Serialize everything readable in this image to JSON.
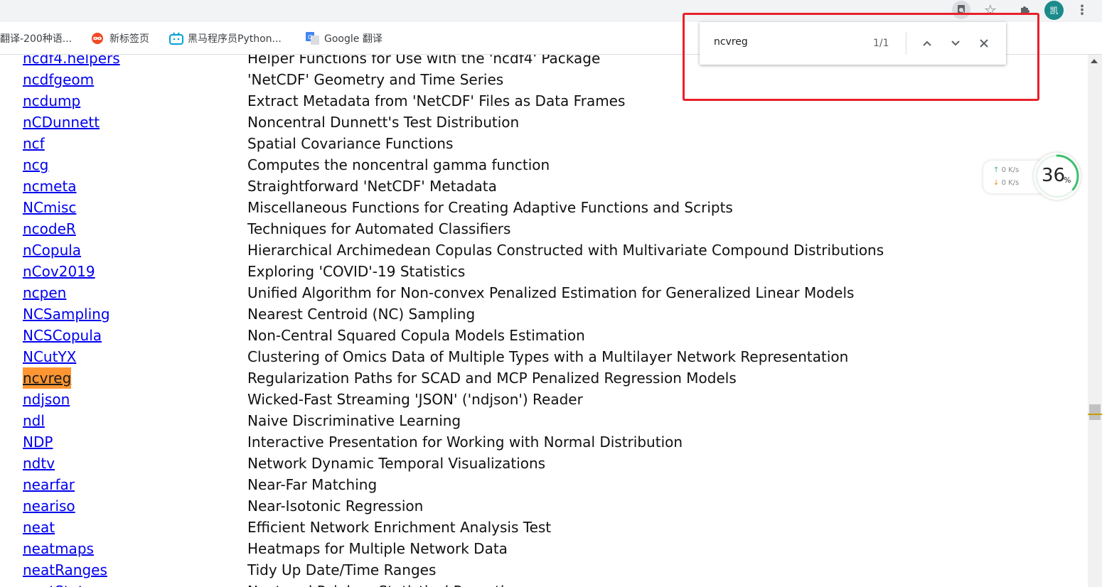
{
  "bookmarks": [
    {
      "label": "翻译-200种语...",
      "icon": "translate-icon"
    },
    {
      "label": "新标签页",
      "icon": "infinity-icon"
    },
    {
      "label": "黑马程序员Python...",
      "icon": "bilibili-icon"
    },
    {
      "label": "Google 翻译",
      "icon": "google-translate-icon"
    }
  ],
  "toolbar": {
    "avatar_text": "凯"
  },
  "find": {
    "query": "ncvreg",
    "count": "1/1"
  },
  "widget": {
    "upload": "0  K/s",
    "download": "0  K/s",
    "cpu_value": "36",
    "cpu_unit": "%",
    "cpu_percent": 36
  },
  "packages": [
    {
      "name": "ncdf4.helpers",
      "desc": "Helper Functions for Use with the 'ncdf4' Package"
    },
    {
      "name": "ncdfgeom",
      "desc": "'NetCDF' Geometry and Time Series"
    },
    {
      "name": "ncdump",
      "desc": "Extract Metadata from 'NetCDF' Files as Data Frames"
    },
    {
      "name": "nCDunnett",
      "desc": "Noncentral Dunnett's Test Distribution"
    },
    {
      "name": "ncf",
      "desc": "Spatial Covariance Functions"
    },
    {
      "name": "ncg",
      "desc": "Computes the noncentral gamma function"
    },
    {
      "name": "ncmeta",
      "desc": "Straightforward 'NetCDF' Metadata"
    },
    {
      "name": "NCmisc",
      "desc": "Miscellaneous Functions for Creating Adaptive Functions and Scripts"
    },
    {
      "name": "ncodeR",
      "desc": "Techniques for Automated Classifiers"
    },
    {
      "name": "nCopula",
      "desc": "Hierarchical Archimedean Copulas Constructed with Multivariate Compound Distributions"
    },
    {
      "name": "nCov2019",
      "desc": "Exploring 'COVID'-19 Statistics"
    },
    {
      "name": "ncpen",
      "desc": "Unified Algorithm for Non-convex Penalized Estimation for Generalized Linear Models"
    },
    {
      "name": "NCSampling",
      "desc": "Nearest Centroid (NC) Sampling"
    },
    {
      "name": "NCSCopula",
      "desc": "Non-Central Squared Copula Models Estimation"
    },
    {
      "name": "NCutYX",
      "desc": "Clustering of Omics Data of Multiple Types with a Multilayer Network Representation"
    },
    {
      "name": "ncvreg",
      "desc": "Regularization Paths for SCAD and MCP Penalized Regression Models",
      "highlighted": true
    },
    {
      "name": "ndjson",
      "desc": "Wicked-Fast Streaming 'JSON' ('ndjson') Reader"
    },
    {
      "name": "ndl",
      "desc": "Naive Discriminative Learning"
    },
    {
      "name": "NDP",
      "desc": "Interactive Presentation for Working with Normal Distribution"
    },
    {
      "name": "ndtv",
      "desc": "Network Dynamic Temporal Visualizations"
    },
    {
      "name": "nearfar",
      "desc": "Near-Far Matching"
    },
    {
      "name": "neariso",
      "desc": "Near-Isotonic Regression"
    },
    {
      "name": "neat",
      "desc": "Efficient Network Enrichment Analysis Test"
    },
    {
      "name": "neatmaps",
      "desc": "Heatmaps for Multiple Network Data"
    },
    {
      "name": "neatRanges",
      "desc": "Tidy Up Date/Time Ranges"
    },
    {
      "name": "neatStats",
      "desc": "Neat and Painless Statistical Reporting"
    }
  ]
}
